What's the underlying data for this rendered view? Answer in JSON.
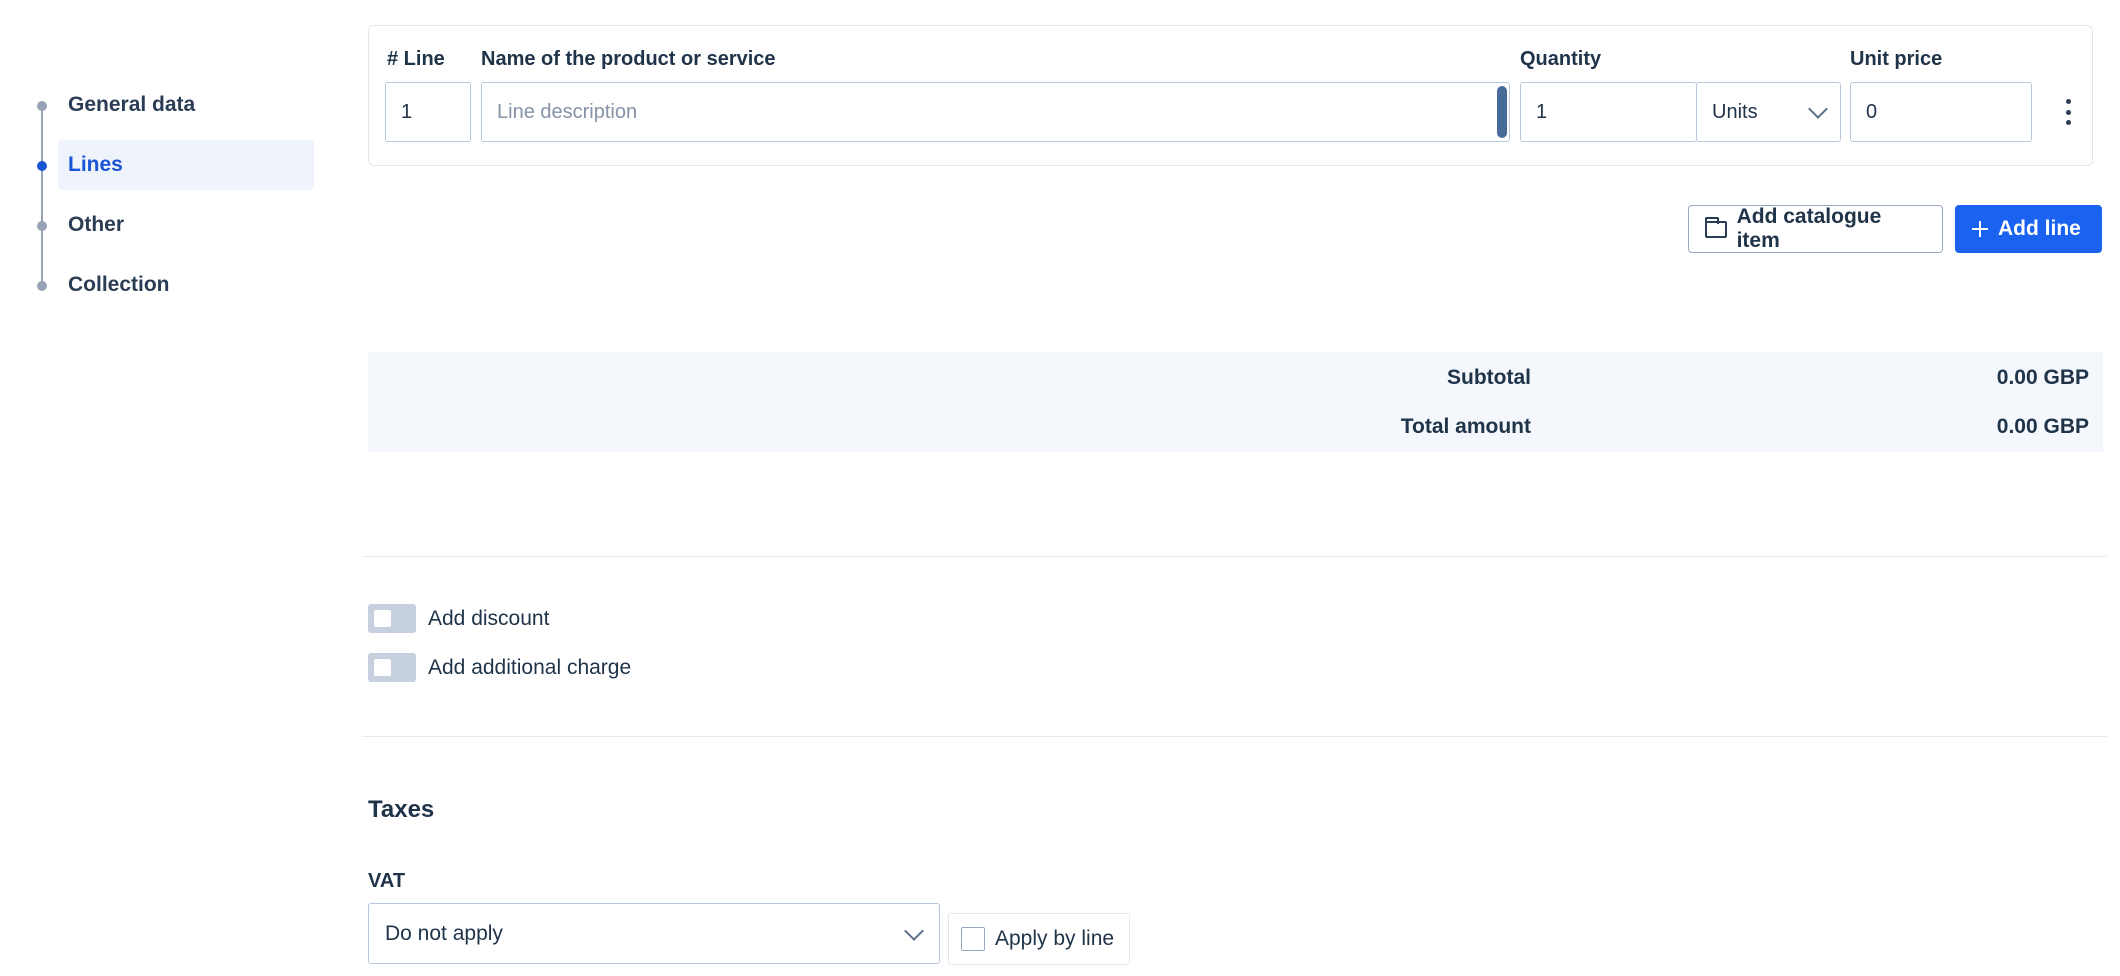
{
  "nav": {
    "steps": [
      {
        "label": "General data",
        "active": false
      },
      {
        "label": "Lines",
        "active": true
      },
      {
        "label": "Other",
        "active": false
      },
      {
        "label": "Collection",
        "active": false
      }
    ]
  },
  "lines": {
    "headers": {
      "line": "# Line",
      "name": "Name of the product or service",
      "quantity": "Quantity",
      "unit_price": "Unit price"
    },
    "row": {
      "line_number": "1",
      "description_placeholder": "Line description",
      "quantity": "1",
      "unit": "Units",
      "unit_price": "0"
    }
  },
  "actions": {
    "add_catalogue_item": "Add catalogue item",
    "add_line": "Add line"
  },
  "totals": {
    "subtotal_label": "Subtotal",
    "subtotal_value": "0.00 GBP",
    "total_label": "Total amount",
    "total_value": "0.00 GBP"
  },
  "adjustments": {
    "discount_label": "Add discount",
    "discount_enabled": false,
    "charge_label": "Add additional charge",
    "charge_enabled": false
  },
  "taxes": {
    "title": "Taxes",
    "vat_label": "VAT",
    "vat_value": "Do not apply",
    "apply_by_line_label": "Apply by line",
    "apply_by_line_checked": false
  },
  "colors": {
    "primary": "#1a63f0",
    "active_step": "#1a55d6",
    "text": "#1f3349",
    "totals_bg": "#f4f7fc"
  }
}
